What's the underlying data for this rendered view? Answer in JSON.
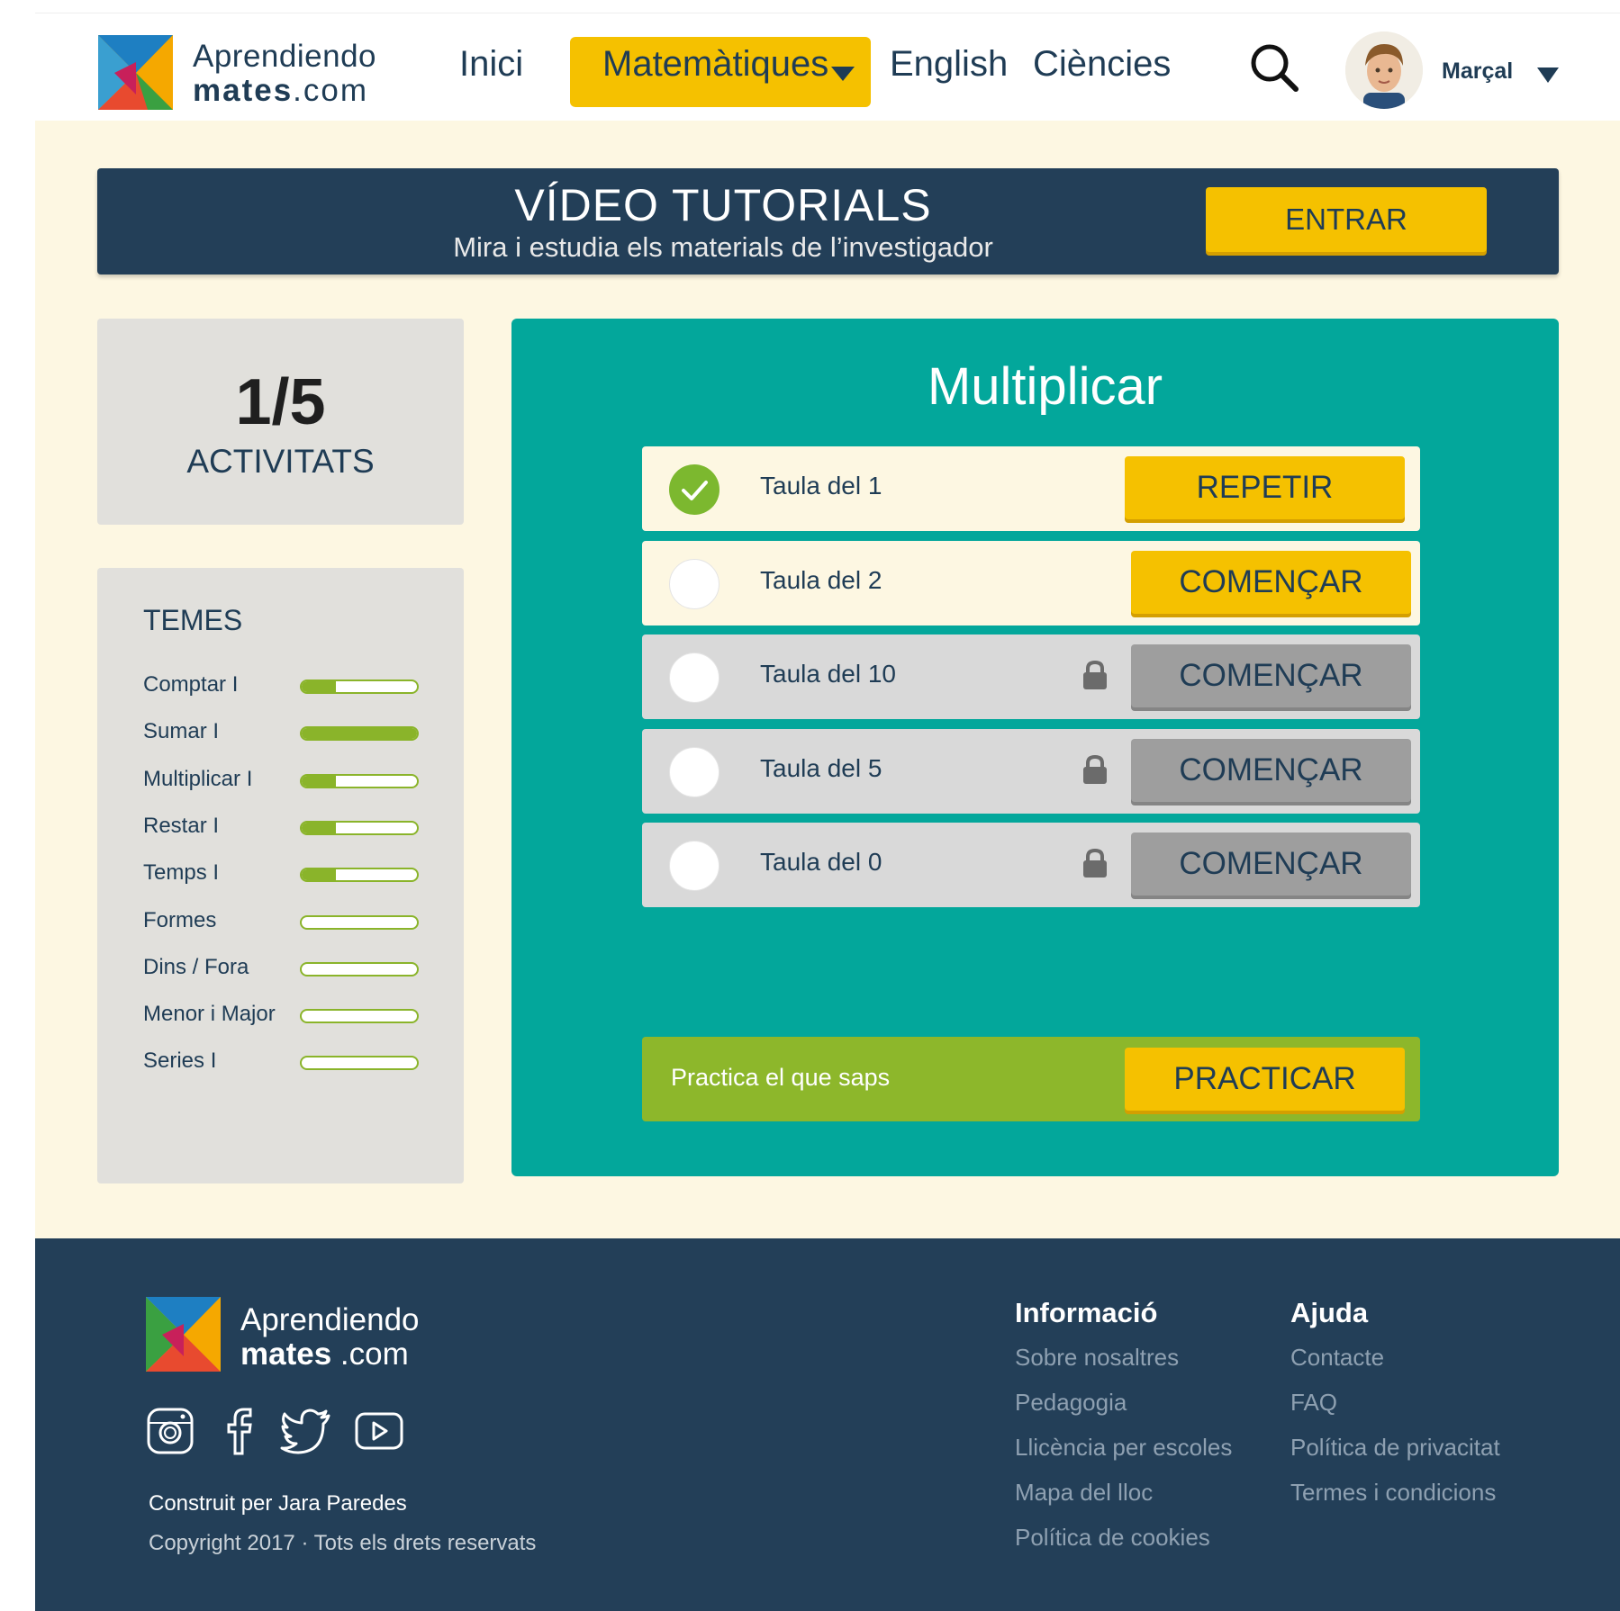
{
  "header": {
    "logo": {
      "line1": "Aprendiendo",
      "line2_bold": "mates",
      "line2_rest": ".com"
    },
    "nav": {
      "home": "Inici",
      "active": "Matemàtiques",
      "english": "English",
      "science": "Ciències"
    },
    "user": {
      "name": "Marçal"
    }
  },
  "banner": {
    "title": "VÍDEO TUTORIALS",
    "subtitle": "Mira i estudia els materials de l’investigador",
    "button": "ENTRAR"
  },
  "progress": {
    "value": "1/5",
    "label": "ACTIVITATS"
  },
  "topics": {
    "title": "TEMES",
    "items": [
      {
        "label": "Comptar I",
        "progress": 0.3
      },
      {
        "label": "Sumar I",
        "progress": 1.0
      },
      {
        "label": "Multiplicar I",
        "progress": 0.3
      },
      {
        "label": "Restar I",
        "progress": 0.3
      },
      {
        "label": "Temps I",
        "progress": 0.3
      },
      {
        "label": "Formes",
        "progress": 0
      },
      {
        "label": "Dins / Fora",
        "progress": 0
      },
      {
        "label": "Menor i Major",
        "progress": 0
      },
      {
        "label": "Series I",
        "progress": 0
      }
    ]
  },
  "lesson": {
    "title": "Multiplicar",
    "rows": [
      {
        "label": "Taula del 1",
        "status": "done",
        "button": "REPETIR"
      },
      {
        "label": "Taula del 2",
        "status": "open",
        "button": "COMENÇAR"
      },
      {
        "label": "Taula del 10",
        "status": "locked",
        "button": "COMENÇAR"
      },
      {
        "label": "Taula del 5",
        "status": "locked",
        "button": "COMENÇAR"
      },
      {
        "label": "Taula del 0",
        "status": "locked",
        "button": "COMENÇAR"
      }
    ],
    "practice": {
      "label": "Practica el que saps",
      "button": "PRACTICAR"
    }
  },
  "footer": {
    "logo": {
      "line1": "Aprendiendo",
      "line2_bold": "mates",
      "line2_rest": " .com"
    },
    "social": [
      "instagram-icon",
      "facebook-icon",
      "twitter-icon",
      "youtube-icon"
    ],
    "built_by": "Construit per Jara Paredes",
    "copyright": "Copyright 2017 · Tots els drets reservats",
    "info": {
      "title": "Informació",
      "links": [
        "Sobre nosaltres",
        "Pedagogia",
        "Llicència per escoles",
        "Mapa del lloc",
        "Política de cookies"
      ]
    },
    "help": {
      "title": "Ajuda",
      "links": [
        "Contacte",
        "FAQ",
        "Política de privacitat",
        "Termes i condicions"
      ]
    }
  },
  "colors": {
    "navy": "#233f58",
    "yellow": "#f5c100",
    "teal": "#03a79b",
    "green": "#8db72b",
    "cream": "#fdf7e2"
  }
}
